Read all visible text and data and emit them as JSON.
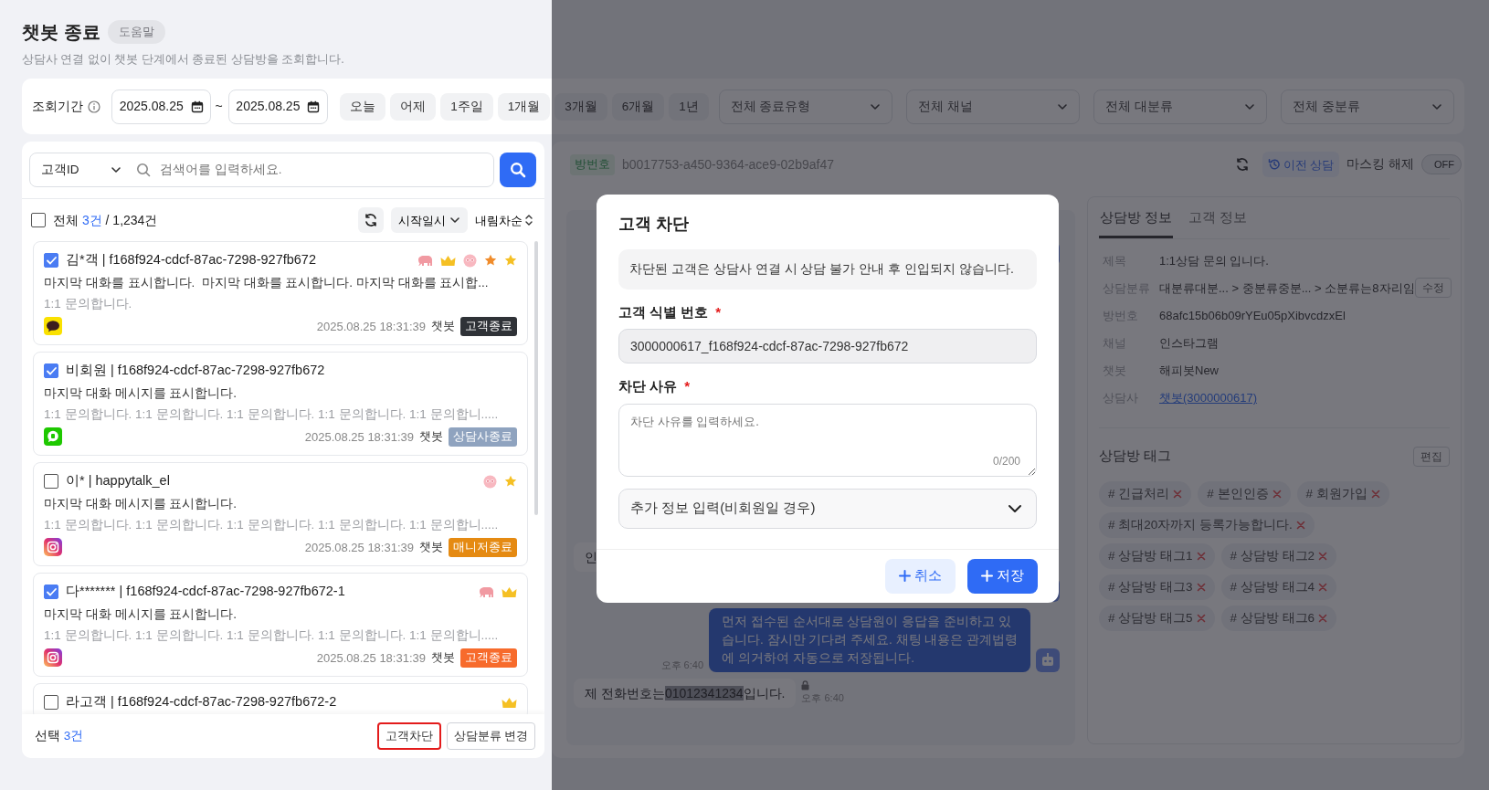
{
  "page": {
    "title": "챗봇 종료",
    "help_label": "도움말",
    "description": "상담사 연결 없이 챗봇 단계에서 종료된 상담방을 조회합니다."
  },
  "filters": {
    "period_label": "조회기간",
    "date_from": "2025.08.25",
    "date_separator": "~",
    "date_to": "2025.08.25",
    "quick_ranges": [
      {
        "label": "오늘",
        "selected": false
      },
      {
        "label": "어제",
        "selected": false
      },
      {
        "label": "1주일",
        "selected": false
      },
      {
        "label": "1개월",
        "selected": false
      },
      {
        "label": "3개월",
        "selected": false
      },
      {
        "label": "6개월",
        "selected": false
      },
      {
        "label": "1년",
        "selected": false
      }
    ],
    "selects": [
      {
        "value": "전체 종료유형"
      },
      {
        "value": "전체 채널"
      },
      {
        "value": "전체 대분류"
      },
      {
        "value": "전체 중분류"
      }
    ]
  },
  "list": {
    "search_type": "고객ID",
    "search_placeholder": "검색어를 입력하세요.",
    "select_all_checked": false,
    "total_label": "전체",
    "result_count": "3건",
    "total_count": "/ 1,234건",
    "sort_field": "시작일시",
    "sort_order": "내림차순",
    "items": [
      {
        "checked": true,
        "name": "김*객 | f168f924-cdcf-87ac-7298-927fb672",
        "icons": [
          {
            "kind": "elephant"
          },
          {
            "kind": "crown"
          },
          {
            "kind": "emoji"
          },
          {
            "kind": "star",
            "color": "#f08c2b"
          },
          {
            "kind": "star",
            "color": "#f5c024"
          }
        ],
        "message": "마지막 대화를 표시합니다.  마지막 대화를 표시합니다. 마지막 대화를 표시합...",
        "sub": "1:1 문의합니다.",
        "channel": {
          "kind": "kakao"
        },
        "time": "2025.08.25 18:31:39",
        "agent": "챗봇",
        "status": "고객종료",
        "color": "#2f3237"
      },
      {
        "checked": true,
        "name": "비회원 | f168f924-cdcf-87ac-7298-927fb672",
        "message": "마지막 대화 메시지를 표시합니다.",
        "sub": "1:1 문의합니다. 1:1 문의합니다. 1:1 문의합니다. 1:1 문의합니다. 1:1 문의합니.....",
        "channel": {
          "kind": "naver"
        },
        "time": "2025.08.25 18:31:39",
        "agent": "챗봇",
        "status": "상담사종료",
        "color": "#8fa3bf"
      },
      {
        "checked": false,
        "name": "이* | happytalk_el",
        "icons": [
          {
            "kind": "emoji"
          },
          {
            "kind": "star",
            "color": "#f5c024"
          }
        ],
        "message": "마지막 대화 메시지를 표시합니다.",
        "sub": "1:1 문의합니다. 1:1 문의합니다. 1:1 문의합니다. 1:1 문의합니다. 1:1 문의합니.....",
        "channel": {
          "kind": "instagram"
        },
        "time": "2025.08.25 18:31:39",
        "agent": "챗봇",
        "status": "매니저종료",
        "color": "#e58a12"
      },
      {
        "checked": true,
        "name": "다******* | f168f924-cdcf-87ac-7298-927fb672-1",
        "icons": [
          {
            "kind": "elephant"
          },
          {
            "kind": "crown"
          }
        ],
        "message": "마지막 대화 메시지를 표시합니다.",
        "sub": "1:1 문의합니다. 1:1 문의합니다. 1:1 문의합니다. 1:1 문의합니다. 1:1 문의합니.....",
        "channel": {
          "kind": "instagram"
        },
        "time": "2025.08.25 18:31:39",
        "agent": "챗봇",
        "status": "고객종료",
        "color": "#f76b2c"
      },
      {
        "checked": false,
        "name": "라고객 | f168f924-cdcf-87ac-7298-927fb672-2",
        "icons": [
          {
            "kind": "crown"
          }
        ]
      }
    ],
    "footer": {
      "selected_label": "선택",
      "selected_count": "3건",
      "buttons": [
        {
          "label": "고객차단",
          "outlined": true
        },
        {
          "label": "상담분류 변경",
          "outlined": false
        }
      ]
    }
  },
  "room": {
    "room_label": "방번호",
    "room_id": "b0017753-a450-9364-ace9-02b9af47",
    "history_label": "이전 상담",
    "masking_label": "마스킹 해제",
    "masking_on": false,
    "masking_state": "OFF",
    "messages": [
      {
        "kind": "bot"
      },
      {
        "kind": "user",
        "text": "인"
      },
      {
        "kind": "bot"
      },
      {
        "kind": "bot",
        "text": "먼저 접수된 순서대로 상담원이 응답을 준비하고 있습니다. 잠시만 기다려 주세요. 채팅 내용은 관계법령에 의거하여 자동으로 저장됩니다.",
        "time": "오후 6:40"
      },
      {
        "kind": "user",
        "parts": [
          {
            "text": "제 전화번호는",
            "masked": false
          },
          {
            "text": "01012341234",
            "masked": true
          },
          {
            "text": "입니다.",
            "masked": false
          }
        ],
        "locked": true,
        "time": "오후 6:40"
      }
    ],
    "tabs": [
      {
        "label": "상담방 정보",
        "selected": true
      },
      {
        "label": "고객 정보",
        "selected": false
      }
    ],
    "info_rows": [
      {
        "label": "제목",
        "value": "1:1상담 문의 입니다.",
        "kind": "text"
      },
      {
        "label": "상담분류",
        "value": "대분류대분... > 중분류중분... > 소분류는8자리임",
        "kind": "text",
        "action": "수정"
      },
      {
        "label": "방번호",
        "value": "68afc15b06b09rYEu05pXibvcdzxEl",
        "kind": "text"
      },
      {
        "label": "채널",
        "value": "인스타그램",
        "kind": "text"
      },
      {
        "label": "챗봇",
        "value": "해피봇New",
        "kind": "text"
      },
      {
        "label": "상담사",
        "value": "챗봇(3000000617)",
        "kind": "link"
      }
    ],
    "tags_title": "상담방 태그",
    "tags_action": "편집",
    "tags": [
      "# 긴급처리",
      "# 본인인증",
      "# 회원가입",
      "# 최대20자까지 등록가능합니다.",
      "# 상담방 태그1",
      "# 상담방 태그2",
      "# 상담방 태그3",
      "# 상담방 태그4",
      "# 상담방 태그5",
      "# 상담방 태그6"
    ]
  },
  "modal": {
    "title": "고객 차단",
    "notice": "차단된 고객은 상담사 연결 시 상담 불가 안내 후 인입되지 않습니다.",
    "required_mark": "*",
    "fields": [
      {
        "kind": "readonly",
        "label": "고객 식별 번호",
        "required": true,
        "value": "3000000617_f168f924-cdcf-87ac-7298-927fb672"
      },
      {
        "kind": "textarea",
        "label": "차단 사유",
        "required": true,
        "placeholder": "차단 사유를 입력하세요.",
        "counter": "0/200"
      }
    ],
    "accordion": {
      "label": "추가 정보 입력(비회원일 경우)",
      "expanded": false
    },
    "buttons": [
      {
        "label": "취소",
        "kind": "secondary"
      },
      {
        "label": "저장",
        "kind": "primary"
      }
    ]
  }
}
